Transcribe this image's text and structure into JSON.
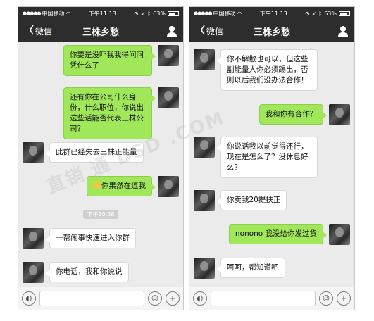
{
  "left": {
    "status": {
      "carrier": "中国移动",
      "time": "下午11:13",
      "battery": "63%"
    },
    "nav": {
      "back_label": "微信",
      "title": "三株乡愁"
    },
    "messages": [
      {
        "text": "你要是没吓我我得问问凭什么了"
      },
      {
        "text": "还有你在公司什么身份，什么职位，你说出这些话能否代表三株公司？"
      },
      {
        "text": "此群已经失去三株正能量"
      },
      {
        "text": "你果然在逗我"
      },
      {
        "text": "一帮闹事快速进入你群"
      },
      {
        "text": "你电话，我和你说说"
      }
    ],
    "timestamp": "下午10:58"
  },
  "right": {
    "status": {
      "carrier": "中国移动",
      "time": "下午11:13",
      "battery": "63%"
    },
    "nav": {
      "back_label": "微信",
      "title": "三株乡愁"
    },
    "messages": [
      {
        "text": "你不解散也可以，但这些副能量人你必须踢出，否则以后我们没办法合作！"
      },
      {
        "text": "我和你有合作？"
      },
      {
        "text": "你说话我以前觉得还行，现在是怎么了？没休息好么？"
      },
      {
        "text": "你卖我20提扶正"
      },
      {
        "text": "nonono 我没给你发过货"
      },
      {
        "text": "呵呵，都知道吧"
      }
    ]
  },
  "watermark": "直销  通  DSD  .COM",
  "icons": {
    "voice": "voice-icon",
    "emoji": "emoji-icon",
    "plus": "plus-icon",
    "contact": "person-icon",
    "back": "chevron-left-icon"
  },
  "colors": {
    "nav_bg": "#2d2d2d",
    "my_bubble": "#a0e75a",
    "their_bubble": "#ffffff",
    "chat_bg": "#ebebeb"
  }
}
